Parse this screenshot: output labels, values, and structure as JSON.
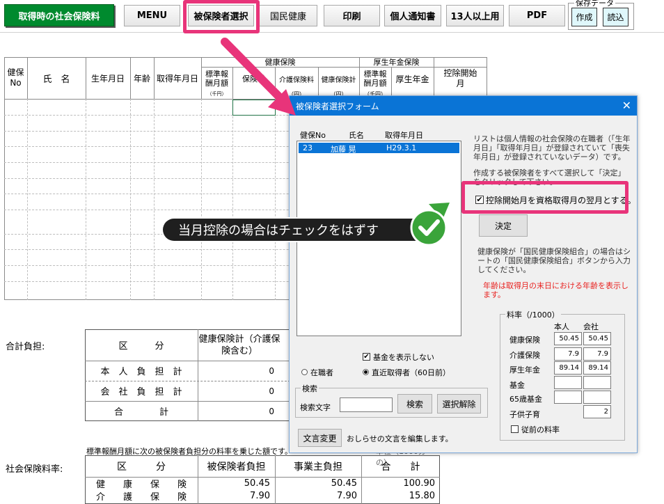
{
  "toolbar": {
    "title": "取得時の社会保険料",
    "menu": "MENU",
    "select_insured": "被保険者選択",
    "national_health": "国民健康",
    "print": "印刷",
    "personal_notice": "個人通知書",
    "over13": "13人以上用",
    "pdf": "PDF",
    "save_data_legend": "保存データ",
    "create": "作成",
    "load": "読込"
  },
  "sheet": {
    "headers": {
      "kenpo_no": "健保No",
      "name": "氏　名",
      "birth": "生年月日",
      "age": "年齢",
      "acquire": "取得年月日",
      "health_group": "健康保険",
      "pension_group": "厚生年金保険",
      "std_remun": "標準報酬月額",
      "thousand_yen": "（千円）",
      "health_ins": "保険料",
      "care_ins": "介護保険料",
      "health_total": "健康保険計",
      "pension_std": "標準報酬月額",
      "pension": "厚生年金",
      "deduct_start": "控除開始月",
      "yen1": "（円）",
      "yen2": "（円）",
      "yen3": "（千円）"
    },
    "total_label": "合計負担:",
    "total_table": {
      "col_cat": "区　　　分",
      "col_health": "健康保険計（介護保険含む）",
      "rows": [
        {
          "label": "本　人　負　担　計",
          "value": "0"
        },
        {
          "label": "会　社　負　担　計",
          "value": "0"
        },
        {
          "label": "合　　　　計",
          "value": "0"
        }
      ]
    },
    "rate_note": "標準報酬月額に次の被保険者負担分の料率を乗じた額です。",
    "rate_note_right": "単位（1000分の）",
    "rate_label": "社会保険料率:",
    "rate_table": {
      "col_cat": "区　　　分",
      "col_insured": "被保険者負担",
      "col_employer": "事業主負担",
      "col_total": "合　　計",
      "rows": [
        {
          "label": "健　　康　　保　　険",
          "insured": "50.45",
          "employer": "50.45",
          "total": "100.90"
        },
        {
          "label": "介　　護　　保　　険",
          "insured": "7.90",
          "employer": "7.90",
          "total": "15.80"
        }
      ]
    }
  },
  "dialog": {
    "title": "被保険者選択フォーム",
    "list_headers": {
      "no": "健保No",
      "name": "氏名",
      "date": "取得年月日"
    },
    "list_items": [
      {
        "no": "23",
        "name": "加藤 晃",
        "date": "H29.3.1"
      }
    ],
    "desc1": "リストは個人情報の社会保険の在職者（「生年月日」「取得年月日」が登録されていて「喪失年月日」が登録されていないデータ）です。",
    "desc2": "作成する被保険者をすべて選択して「決定」をクリックして下さい。",
    "checkbox_deduct": "控除開始月を資格取得月の翌月とする。",
    "decide": "決定",
    "desc3": "健康保険が「国民健康保険組合」の場合はシートの「国民健康保険組合」ボタンから入力してください。",
    "age_note": "年齢は取得月の末日における年齢を表示します。",
    "rate_group": "料率（/1000）",
    "rate_person": "本人",
    "rate_company": "会社",
    "rates": [
      {
        "label": "健康保険",
        "person": "50.45",
        "company": "50.45"
      },
      {
        "label": "介護保険",
        "person": "7.9",
        "company": "7.9"
      },
      {
        "label": "厚生年金",
        "person": "89.14",
        "company": "89.14"
      },
      {
        "label": "基金",
        "person": "",
        "company": ""
      },
      {
        "label": "65歳基金",
        "person": "",
        "company": ""
      },
      {
        "label": "子供子育",
        "person": null,
        "company": "2"
      }
    ],
    "old_rate": "従前の料率",
    "hide_fund": "基金を表示しない",
    "radio_active": "在職者",
    "radio_recent": "直近取得者（60日前）",
    "search_group": "検索",
    "search_label": "検索文字",
    "search_value": "",
    "search_btn": "検索",
    "clear_btn": "選択解除",
    "text_change": "文言変更",
    "text_change_note": "おしらせの文言を編集します。"
  },
  "callout": "当月控除の場合はチェックをはずす",
  "colors": {
    "highlight": "#e8347a",
    "green": "#008a2e",
    "titlebar": "#0a74d6"
  }
}
